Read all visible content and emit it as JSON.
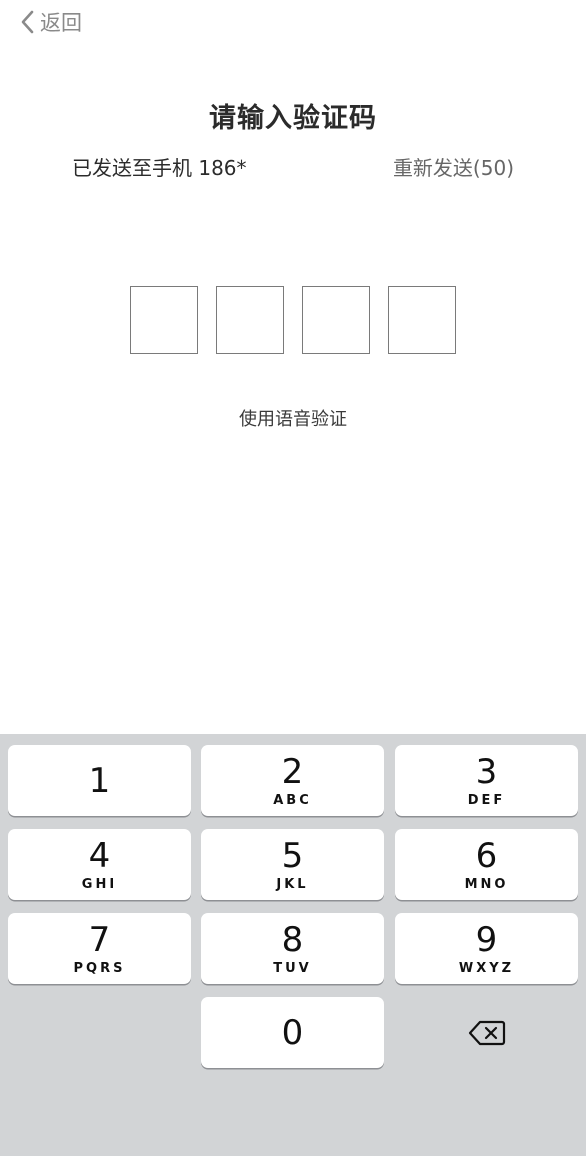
{
  "nav": {
    "back_label": "返回",
    "back_icon": "chevron-left-icon"
  },
  "title": "请输入验证码",
  "sent_text": "已发送至手机 186*",
  "resend_label": "重新发送(50)",
  "code_boxes_count": 4,
  "voice_link": "使用语音验证",
  "keypad": {
    "keys": [
      {
        "digit": "1",
        "letters": ""
      },
      {
        "digit": "2",
        "letters": "ABC"
      },
      {
        "digit": "3",
        "letters": "DEF"
      },
      {
        "digit": "4",
        "letters": "GHI"
      },
      {
        "digit": "5",
        "letters": "JKL"
      },
      {
        "digit": "6",
        "letters": "MNO"
      },
      {
        "digit": "7",
        "letters": "PQRS"
      },
      {
        "digit": "8",
        "letters": "TUV"
      },
      {
        "digit": "9",
        "letters": "WXYZ"
      },
      {
        "digit": "0",
        "letters": ""
      }
    ],
    "delete_icon": "backspace-icon"
  },
  "colors": {
    "keypad_bg": "#d2d4d6",
    "key_bg": "#ffffff"
  }
}
